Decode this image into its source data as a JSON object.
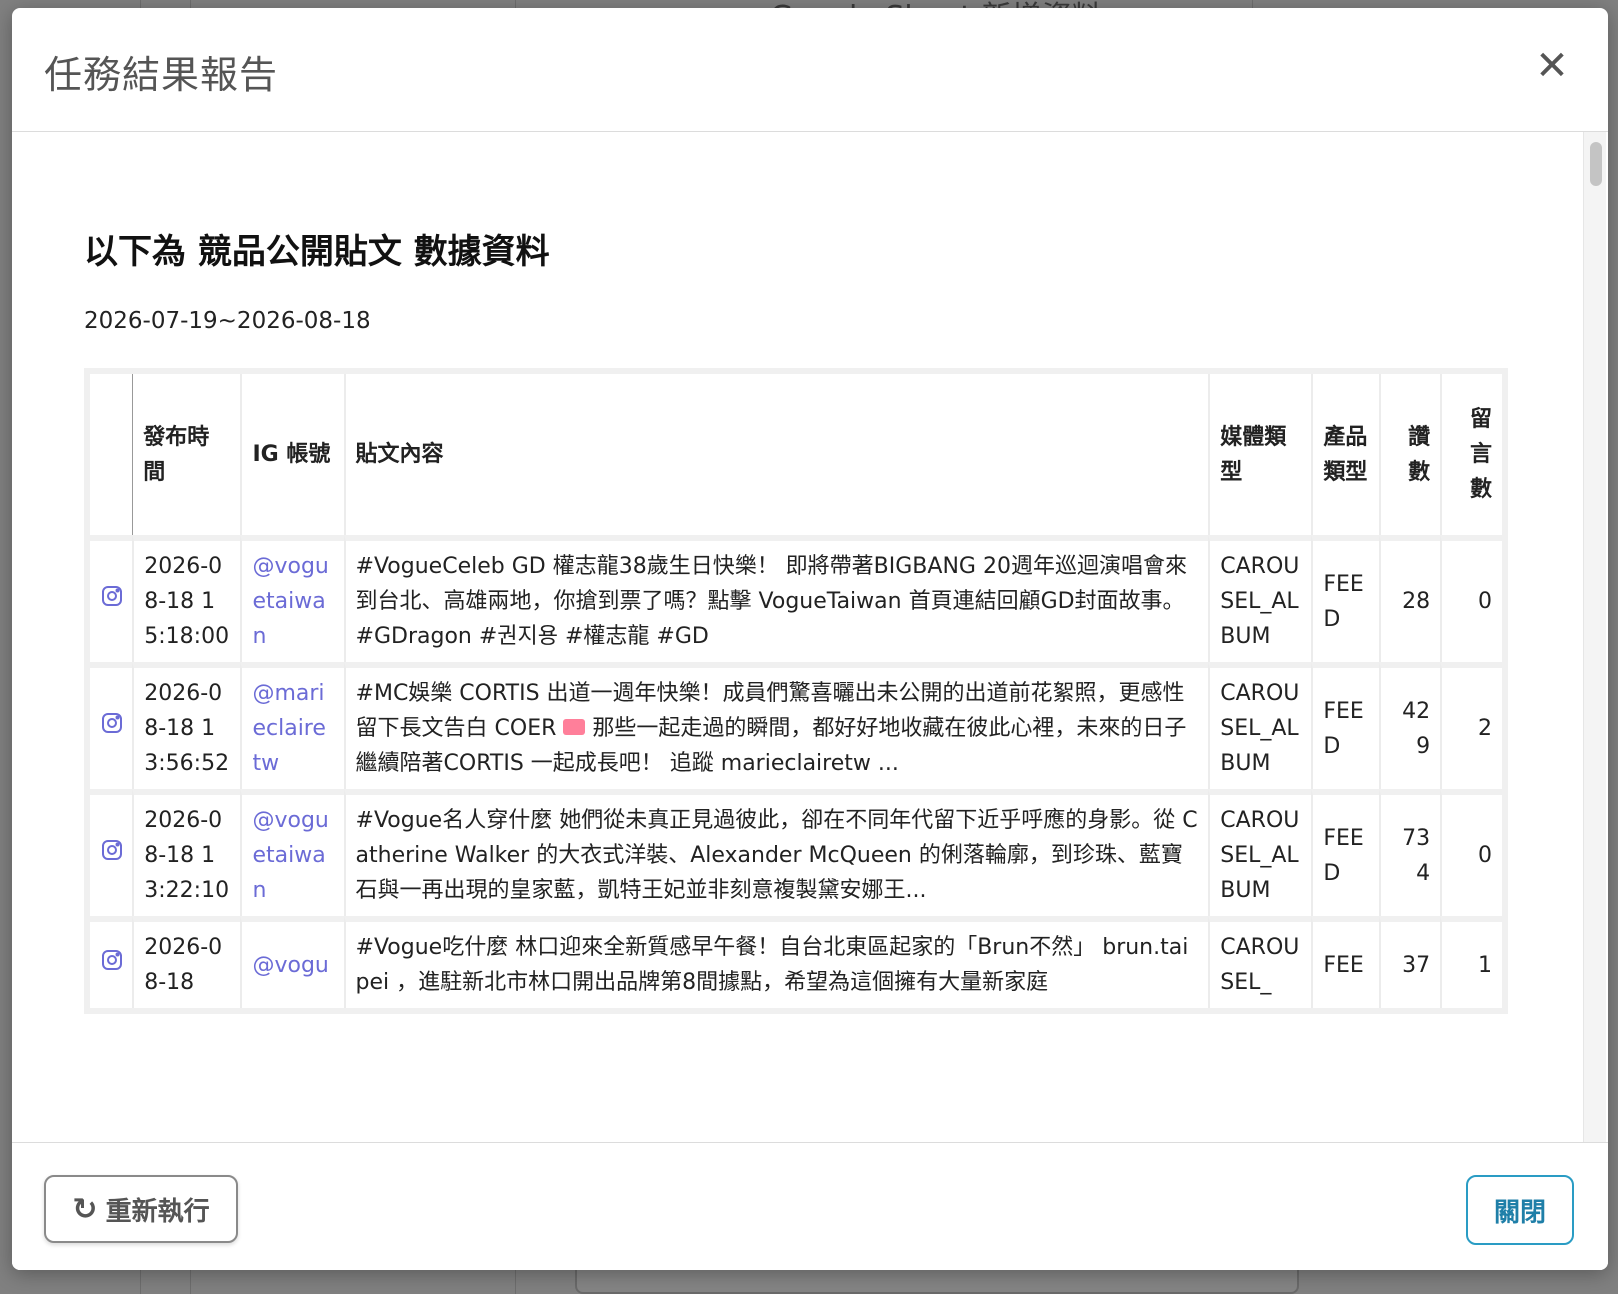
{
  "background": {
    "title": "Google Sheet 新增資料"
  },
  "modal": {
    "title": "任務結果報告",
    "close_icon": "close-icon"
  },
  "report": {
    "heading": "以下為 競品公開貼文 數據資料",
    "date_range": "2026-07-19~2026-08-18"
  },
  "table": {
    "headers": {
      "icon": "",
      "date": "發布時間",
      "account": "IG 帳號",
      "content": "貼文內容",
      "media_type": "媒體類型",
      "product_type": "產品類型",
      "likes": "讚數",
      "comments": "留言數"
    },
    "rows": [
      {
        "icon": "instagram-icon",
        "date": "2026-08-18 15:18:00",
        "account": "@voguetaiwan",
        "content": "#VogueCeleb GD 權志龍38歲生日快樂！ 即將帶著BIGBANG 20週年巡迴演唱會來到台北、高雄兩地，你搶到票了嗎？點擊 VogueTaiwan 首頁連結回顧GD封面故事。 #GDragon #권지용 #權志龍 #GD",
        "media_type": "CAROUSEL_ALBUM",
        "product_type": "FEED",
        "likes": "28",
        "comments": "0"
      },
      {
        "icon": "instagram-icon",
        "date": "2026-08-18 13:56:52",
        "account": "@marieclairetw",
        "content_before_emoji": "#MC娛樂 CORTIS 出道一週年快樂！成員們驚喜曬出未公開的出道前花絮照，更感性留下長文告白 COER ",
        "content_after_emoji": " 那些一起走過的瞬間，都好好地收藏在彼此心裡，未來的日子繼續陪著CORTIS 一起成長吧！ 追蹤 marieclairetw ...",
        "media_type": "CAROUSEL_ALBUM",
        "product_type": "FEED",
        "likes": "429",
        "comments": "2"
      },
      {
        "icon": "instagram-icon",
        "date": "2026-08-18 13:22:10",
        "account": "@voguetaiwan",
        "content": "#Vogue名人穿什麼 她們從未真正見過彼此，卻在不同年代留下近乎呼應的身影。從 Catherine Walker 的大衣式洋裝、Alexander McQueen 的俐落輪廓，到珍珠、藍寶石與一再出現的皇家藍，凱特王妃並非刻意複製黛安娜王...",
        "media_type": "CAROUSEL_ALBUM",
        "product_type": "FEED",
        "likes": "734",
        "comments": "0"
      },
      {
        "icon": "instagram-icon",
        "date": "2026-08-18",
        "account": "@vogu",
        "content": "#Vogue吃什麼 林口迎來全新質感早午餐！自台北東區起家的「Brun不然」 brun.taipei ，進駐新北市林口開出品牌第8間據點，希望為這個擁有大量新家庭",
        "media_type": "CAROUSEL_",
        "product_type": "FEE",
        "likes": "37",
        "comments": "1"
      }
    ]
  },
  "footer": {
    "rerun_label": "重新執行",
    "rerun_icon": "refresh-icon",
    "close_label": "關閉"
  },
  "colors": {
    "link": "#6b6bd6",
    "close_button_border": "#2a9cc4",
    "close_button_text": "#1f7fa8"
  }
}
